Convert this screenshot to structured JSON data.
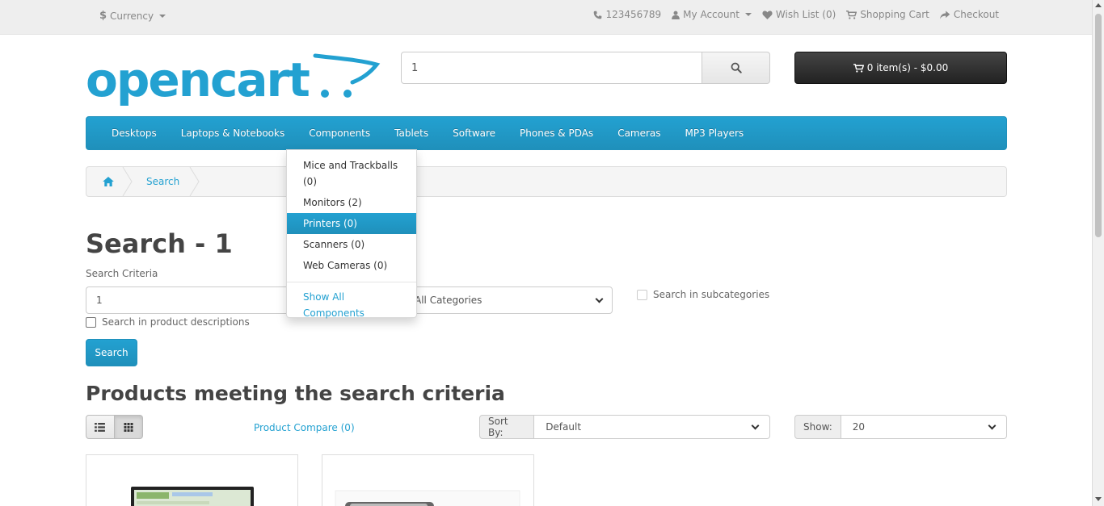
{
  "top_bar": {
    "currency_symbol": "$",
    "currency_label": "Currency",
    "phone": "123456789",
    "my_account": "My Account",
    "wish_list": "Wish List (0)",
    "shopping_cart": "Shopping Cart",
    "checkout": "Checkout"
  },
  "logo": {
    "text": "opencart"
  },
  "search": {
    "value": "1"
  },
  "cart": {
    "label": "0 item(s) - $0.00"
  },
  "menu": {
    "items": [
      {
        "label": "Desktops"
      },
      {
        "label": "Laptops & Notebooks"
      },
      {
        "label": "Components"
      },
      {
        "label": "Tablets"
      },
      {
        "label": "Software"
      },
      {
        "label": "Phones & PDAs"
      },
      {
        "label": "Cameras"
      },
      {
        "label": "MP3 Players"
      }
    ]
  },
  "dropdown": {
    "items": [
      {
        "label": "Mice and Trackballs (0)"
      },
      {
        "label": "Monitors (2)"
      },
      {
        "label": "Printers (0)"
      },
      {
        "label": "Scanners (0)"
      },
      {
        "label": "Web Cameras (0)"
      }
    ],
    "see_all": "Show All Components"
  },
  "breadcrumb": {
    "current": "Search"
  },
  "page": {
    "title": "Search - 1",
    "criteria_label": "Search Criteria",
    "criteria_value": "1",
    "category_value": "All Categories",
    "subcategories_label": "Search in subcategories",
    "descriptions_label": "Search in product descriptions",
    "search_button": "Search",
    "products_heading": "Products meeting the search criteria",
    "compare_label": "Product Compare (0)",
    "sort_label": "Sort By:",
    "sort_value": "Default",
    "show_label": "Show:",
    "show_value": "20"
  },
  "colors": {
    "accent": "#23a1d1",
    "dark_button": "#222222",
    "topbar_bg": "#eeeeee"
  }
}
